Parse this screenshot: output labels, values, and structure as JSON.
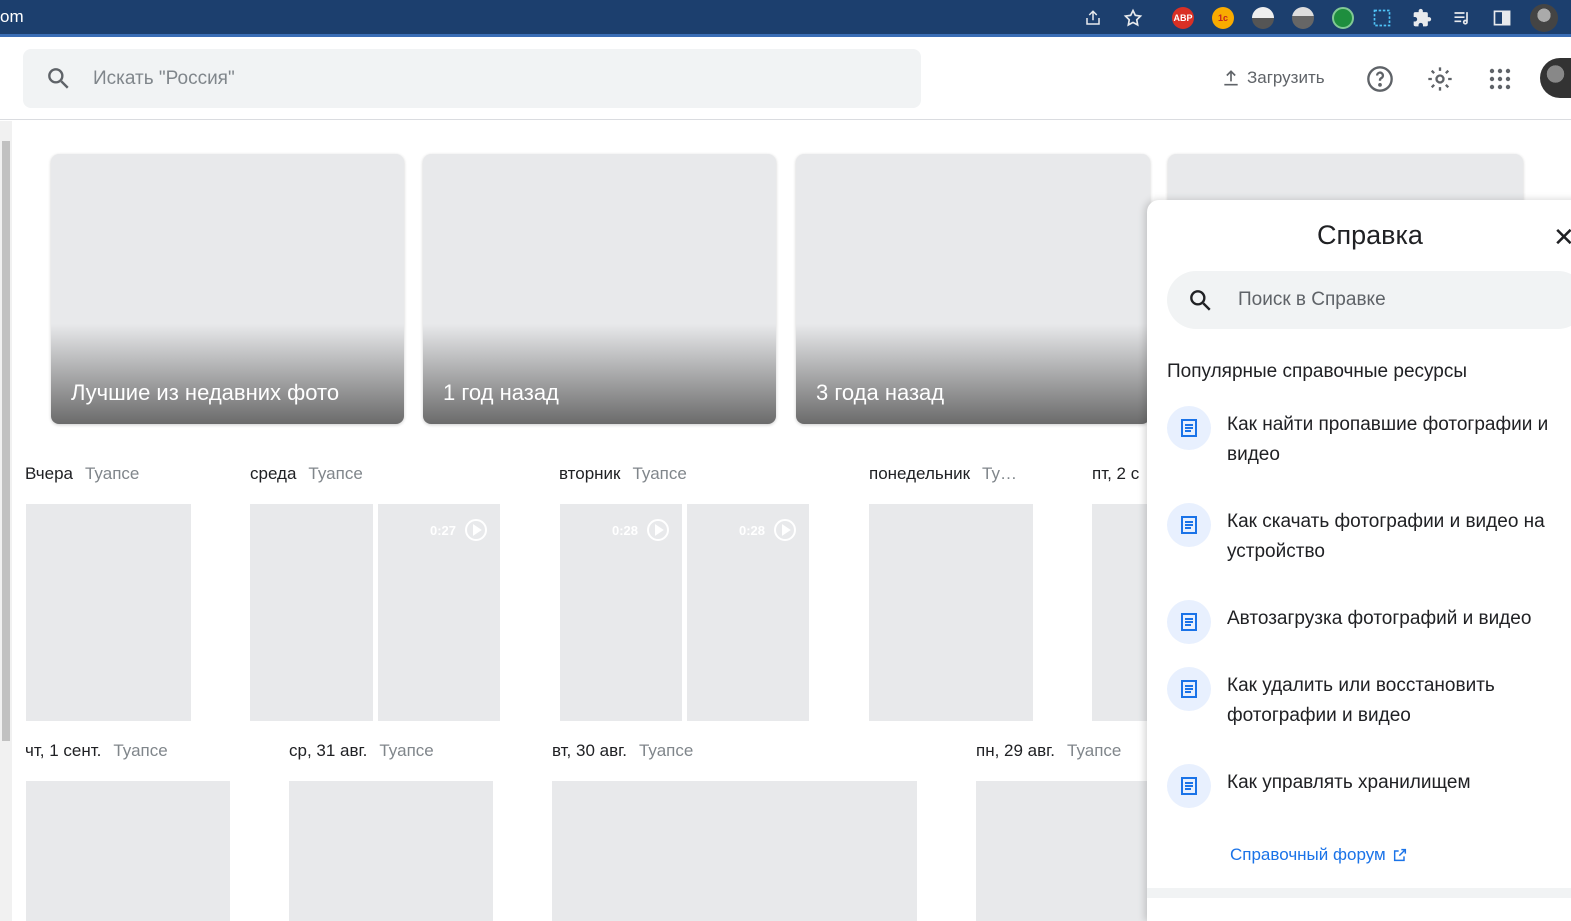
{
  "browser": {
    "url_fragment": "om",
    "extensions": [
      "share-icon",
      "star-icon",
      "abp-icon",
      "extension-1c-icon",
      "extension-dome-icon",
      "extension-globe-icon",
      "extension-green-icon",
      "screenshot-icon",
      "puzzle-icon",
      "media-icon",
      "sidepanel-icon"
    ],
    "abp_label": "ABP",
    "ext_1c_label": "1c"
  },
  "appbar": {
    "search_placeholder": "Искать \"Россия\"",
    "upload_label": "Загрузить"
  },
  "memories": [
    {
      "label": "Лучшие из недавних фото"
    },
    {
      "label": "1 год назад"
    },
    {
      "label": "3 года назад"
    },
    {
      "label": ""
    }
  ],
  "groups_row1": [
    {
      "date": "Вчера",
      "location": "Туапсе"
    },
    {
      "date": "среда",
      "location": "Туапсе"
    },
    {
      "date": "вторник",
      "location": "Туапсе"
    },
    {
      "date": "понедельник",
      "location": "Ту…"
    },
    {
      "date": "пт, 2 с",
      "location": ""
    }
  ],
  "groups_row2": [
    {
      "date": "чт, 1 сент.",
      "location": "Туапсе"
    },
    {
      "date": "ср, 31 авг.",
      "location": "Туапсе"
    },
    {
      "date": "вт, 30 авг.",
      "location": "Туапсе"
    },
    {
      "date": "пн, 29 авг.",
      "location": "Туапсе"
    }
  ],
  "videos": {
    "sreda_video": "0:27",
    "vtornik_video_1": "0:28",
    "vtornik_video_2": "0:28"
  },
  "help": {
    "title": "Справка",
    "search_placeholder": "Поиск в Справке",
    "section_title": "Популярные справочные ресурсы",
    "resources": [
      {
        "label": "Как найти пропавшие фотографии и видео"
      },
      {
        "label": "Как скачать фотографии и видео на устройство"
      },
      {
        "label": "Автозагрузка фотографий и видео"
      },
      {
        "label": "Как удалить или восстановить фотографии и видео"
      },
      {
        "label": "Как управлять хранилищем"
      }
    ],
    "forum_label": "Справочный форум"
  },
  "colors": {
    "browser_bar": "#1c3f6e",
    "accent_link": "#1a73e8",
    "placeholder_tile": "#e8e9eb"
  }
}
